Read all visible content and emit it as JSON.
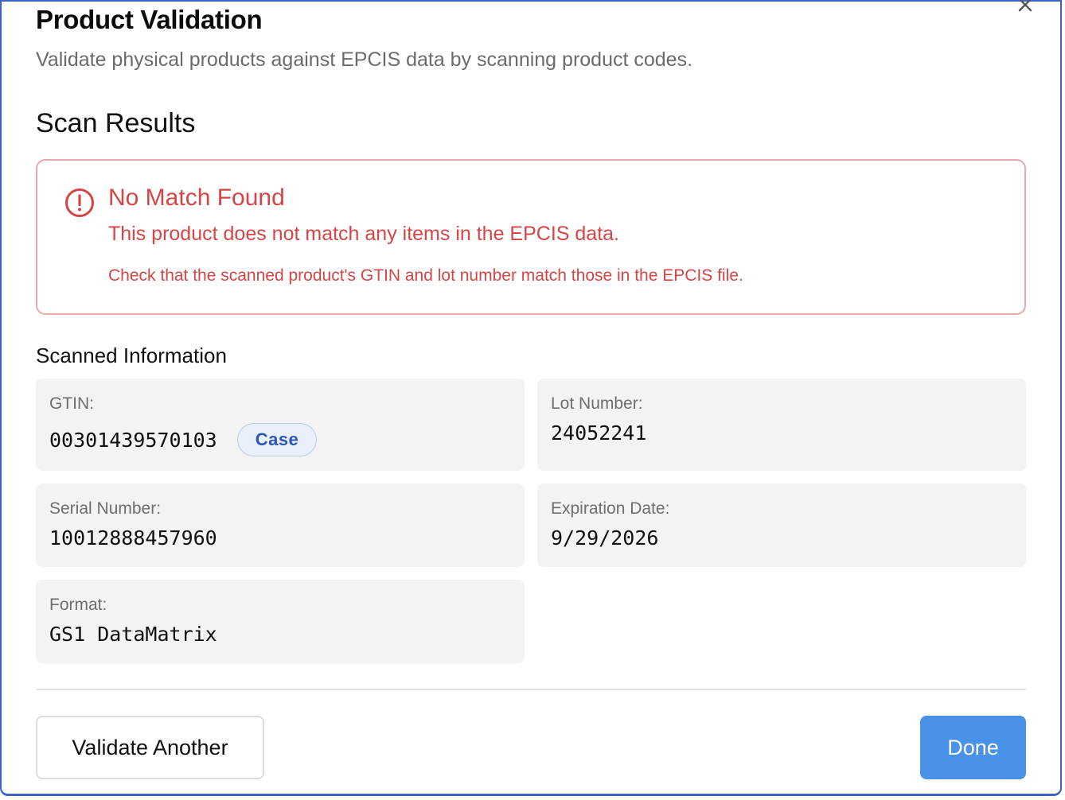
{
  "dialog": {
    "title": "Product Validation",
    "subtitle": "Validate physical products against EPCIS data by scanning product codes.",
    "close_icon": "close-icon"
  },
  "results": {
    "heading": "Scan Results"
  },
  "alert": {
    "icon": "alert-circle-icon",
    "title": "No Match Found",
    "message": "This product does not match any items in the EPCIS data.",
    "hint": "Check that the scanned product's GTIN and lot number match those in the EPCIS file.",
    "color": "#d64545",
    "border_color": "#eaa8a8"
  },
  "scanned": {
    "heading": "Scanned Information",
    "gtin": {
      "label": "GTIN:",
      "value": "00301439570103",
      "badge": "Case"
    },
    "lot": {
      "label": "Lot Number:",
      "value": "24052241"
    },
    "serial": {
      "label": "Serial Number:",
      "value": "10012888457960"
    },
    "expiration": {
      "label": "Expiration Date:",
      "value": "9/29/2026"
    },
    "format": {
      "label": "Format:",
      "value": "GS1 DataMatrix"
    }
  },
  "actions": {
    "validate_another": "Validate Another",
    "done": "Done",
    "primary_color": "#4a92e8"
  }
}
